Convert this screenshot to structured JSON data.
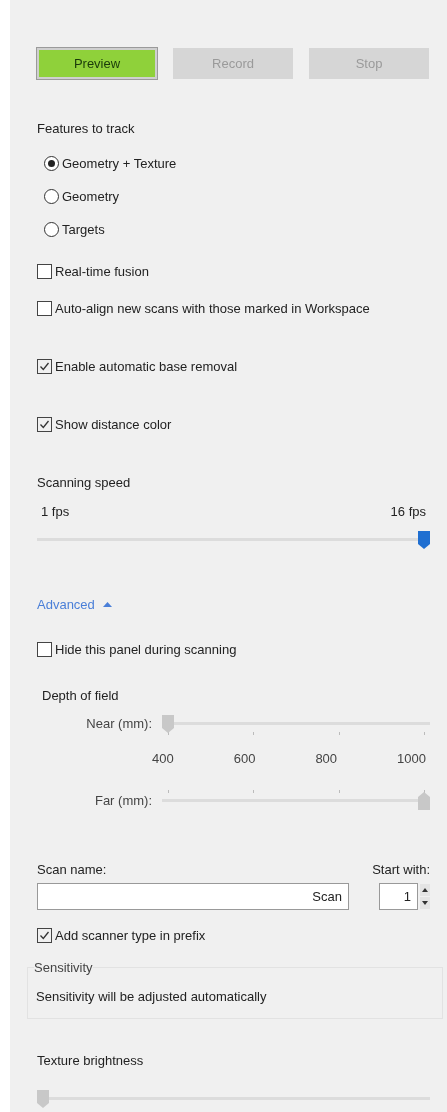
{
  "buttons": [
    {
      "label": "Preview",
      "active": true,
      "disabled": false
    },
    {
      "label": "Record",
      "active": false,
      "disabled": true
    },
    {
      "label": "Stop",
      "active": false,
      "disabled": true
    }
  ],
  "features": {
    "title": "Features to track",
    "options": [
      {
        "label": "Geometry + Texture",
        "selected": true
      },
      {
        "label": "Geometry",
        "selected": false
      },
      {
        "label": "Targets",
        "selected": false
      }
    ]
  },
  "options": [
    {
      "label": "Real-time fusion",
      "checked": false
    },
    {
      "label": "Auto-align new scans with those marked in Workspace",
      "checked": false
    },
    {
      "label": "Enable automatic base removal",
      "checked": true
    },
    {
      "label": "Show distance color",
      "checked": true
    }
  ],
  "scanning_speed": {
    "title": "Scanning speed",
    "min_label": "1 fps",
    "max_label": "16 fps",
    "level": 1,
    "disabled": false
  },
  "advanced": {
    "label": "Advanced",
    "expanded": true
  },
  "hide_panel": {
    "label": "Hide this panel during scanning",
    "checked": false
  },
  "depth_of_field": {
    "title": "Depth of field",
    "near": {
      "label": "Near (mm):",
      "level": 0,
      "disabled": true
    },
    "scale": [
      "400",
      "600",
      "800",
      "1000"
    ],
    "far": {
      "label": "Far (mm):",
      "level": 1,
      "disabled": true
    }
  },
  "scan_name": {
    "label": "Scan name:",
    "value": "Scan"
  },
  "start_with": {
    "label": "Start with:",
    "value": "1"
  },
  "add_scanner_type": {
    "label": "Add scanner type in prefix",
    "checked": true
  },
  "sensitivity": {
    "title": "Sensitivity",
    "text": "Sensitivity will be adjusted automatically"
  },
  "texture_brightness": {
    "title": "Texture brightness",
    "level": 0,
    "disabled": true
  }
}
